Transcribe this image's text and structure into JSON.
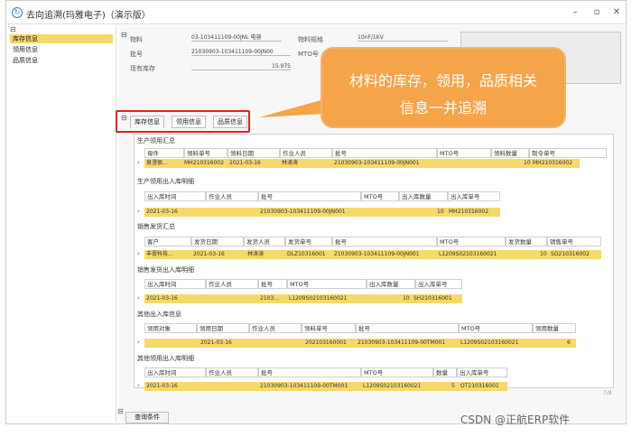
{
  "window": {
    "title": "去向追溯(玛雅电子)（演示版）",
    "minimize": "–",
    "maximize": "▫",
    "close": "✕"
  },
  "sidebar": {
    "collapse": "⊟",
    "items": [
      {
        "label": "库存信息"
      },
      {
        "label": "领用信息"
      },
      {
        "label": "品质信息"
      }
    ]
  },
  "header": {
    "collapse": "⊟",
    "material_label": "物料",
    "material_value": "03-103411109-00JNL 电容",
    "spec_label": "物料规格",
    "spec_value": "10nF/1KV",
    "batch_label": "批号",
    "batch_value": "21030903-103411109-00JN00",
    "mto_label": "MTO号",
    "stock_label": "现有库存",
    "stock_value": "15.975"
  },
  "callout": {
    "line1": "材料的库存，领用，品质相关",
    "line2": "信息一并追溯"
  },
  "tabs": {
    "collapse": "⊟",
    "items": [
      "库存信息",
      "领用信息",
      "品质信息"
    ]
  },
  "panels": {
    "prod_summary": {
      "title": "生产领用汇总",
      "headers": [
        "母件",
        "领料单号",
        "领料日期",
        "作业人员",
        "批号",
        "MTO号",
        "领料数量",
        "制令单号"
      ],
      "row": [
        "泉澄很...",
        "MH210316002",
        "2021-03-16",
        "林涛涛",
        "21030903-103411109-00JN001",
        "",
        "10",
        "MH210316002"
      ]
    },
    "prod_io": {
      "title": "生产领用出入库明细",
      "headers": [
        "出入库时间",
        "作业人员",
        "批号",
        "MTO号",
        "出入库数量",
        "出入库单号"
      ],
      "row": [
        "2021-03-16",
        "",
        "21030903-103411109-00JN001",
        "",
        "10",
        "MH210316002"
      ]
    },
    "sales_summary": {
      "title": "销售发货汇总",
      "headers": [
        "客户",
        "发货日期",
        "发货人员",
        "发货单号",
        "批号",
        "MTO号",
        "发货数量",
        "销售单号"
      ],
      "row": [
        "丰膏科技...",
        "2021-03-16",
        "林涛涛",
        "DLZ10316001",
        "21030903-103411109-00JN001",
        "L1209S02103160021",
        "10",
        "SO210316002"
      ]
    },
    "sales_io": {
      "title": "销售发货出入库明细",
      "headers": [
        "出入库时间",
        "作业人员",
        "批号",
        "MTO号",
        "出入库数量",
        "出入库单号"
      ],
      "row": [
        "2021-03-16",
        "",
        "2103...",
        "L1209S02103160021",
        "10",
        "SH210316001"
      ]
    },
    "other_info": {
      "title": "其他出入库信息",
      "headers": [
        "领用对象",
        "领用日期",
        "作业人员",
        "领料单号",
        "批号",
        "MTO号",
        "领用数量"
      ],
      "row": [
        "",
        "2021-03-16",
        "",
        "202103160001",
        "21030903-103411109-00TM001",
        "L1209S02103160021",
        "6"
      ]
    },
    "other_io": {
      "title": "其他领用出入库明细",
      "headers": [
        "出入库时间",
        "作业人员",
        "批号",
        "MTO号",
        "数量",
        "出入库单号"
      ],
      "row": [
        "2021-03-16",
        "",
        "21030903-103411109-00TM001",
        "L1209S02103160021",
        "5",
        "OT210316001"
      ]
    }
  },
  "footer": {
    "collapse": "⊟",
    "query_button": "查询条件",
    "page_marker": "7/8"
  },
  "watermark": "CSDN @正航ERP软件",
  "colors": {
    "row_highlight": "#f6d96a",
    "callout": "#f5a44a",
    "highlight_border": "#e02020"
  }
}
